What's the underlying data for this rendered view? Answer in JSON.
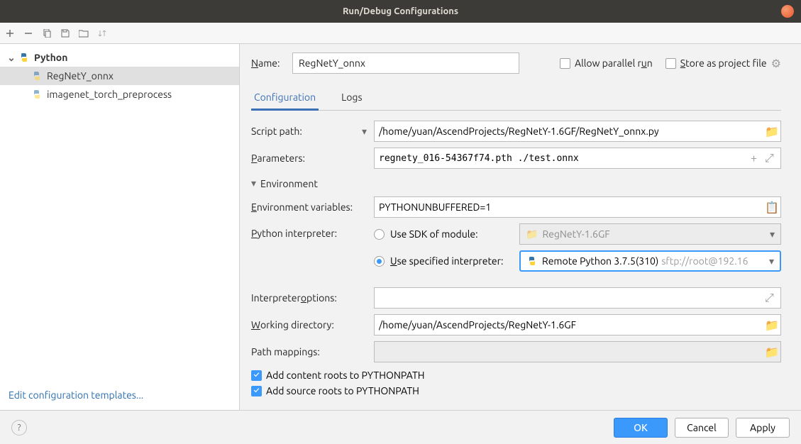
{
  "title": "Run/Debug Configurations",
  "tree": {
    "root": "Python",
    "items": [
      "RegNetY_onnx",
      "imagenet_torch_preprocess"
    ],
    "selected": 0
  },
  "sidebar_link": "Edit configuration templates...",
  "name": {
    "label": "Name:",
    "value": "RegNetY_onnx"
  },
  "allow_parallel": "Allow parallel run",
  "store_project": "Store as project file",
  "tabs": {
    "config": "Configuration",
    "logs": "Logs"
  },
  "form": {
    "script_path": {
      "label": "Script path:",
      "value": "/home/yuan/AscendProjects/RegNetY-1.6GF/RegNetY_onnx.py"
    },
    "parameters": {
      "label": "Parameters:",
      "value": "regnety_016-54367f74.pth ./test.onnx"
    },
    "env_section": "Environment",
    "env_vars": {
      "label": "Environment variables:",
      "value": "PYTHONUNBUFFERED=1"
    },
    "interpreter_label": "Python interpreter:",
    "sdk_module": {
      "label": "Use SDK of module:",
      "value": "RegNetY-1.6GF"
    },
    "spec_interp": {
      "label": "Use specified interpreter:",
      "value": "Remote Python 3.7.5(310)",
      "extra": "sftp://root@192.16"
    },
    "interp_opts": {
      "label": "Interpreter options:",
      "value": ""
    },
    "work_dir": {
      "label": "Working directory:",
      "value": "/home/yuan/AscendProjects/RegNetY-1.6GF"
    },
    "path_map": {
      "label": "Path mappings:",
      "value": ""
    },
    "add_content": "Add content roots to PYTHONPATH",
    "add_source": "Add source roots to PYTHONPATH"
  },
  "buttons": {
    "ok": "OK",
    "cancel": "Cancel",
    "apply": "Apply"
  }
}
